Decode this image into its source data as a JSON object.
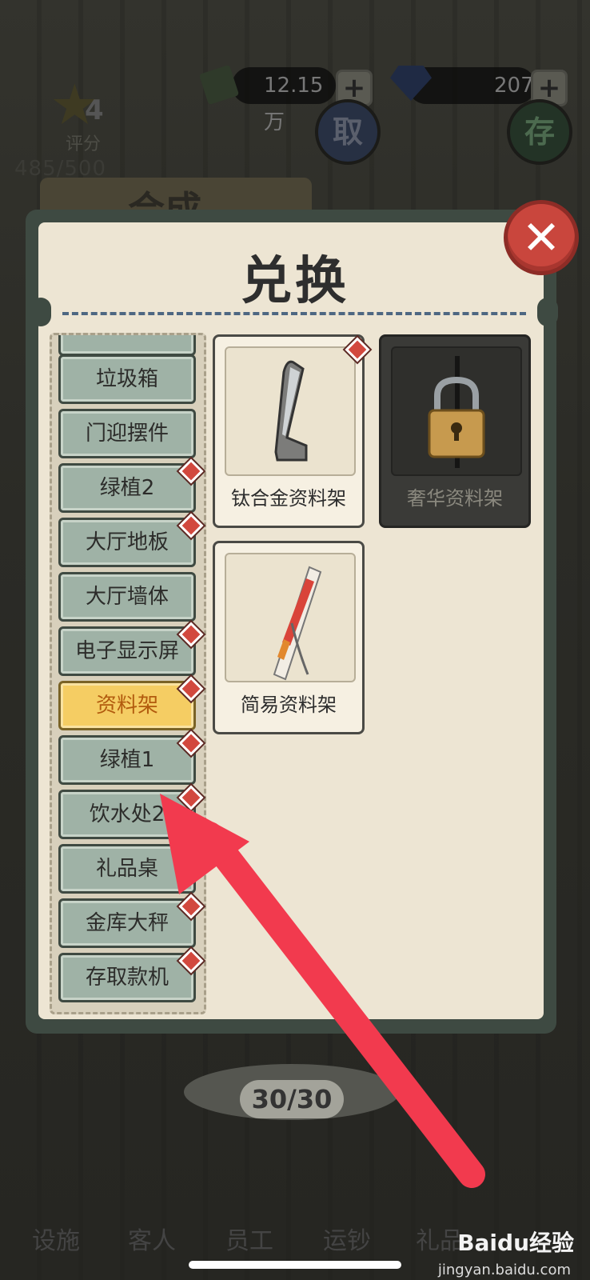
{
  "hud": {
    "cash": "12.15万",
    "diamonds": "207",
    "plus": "+",
    "rank_level": "4",
    "rank_label": "评分",
    "rank_score": "485/500",
    "withdraw_label": "取",
    "deposit_label": "存",
    "back_panel_title": "合成"
  },
  "modal": {
    "title": "兑换",
    "close_symbol": "✕"
  },
  "categories": [
    {
      "label": "垃圾箱",
      "badge": false,
      "selected": false
    },
    {
      "label": "门迎摆件",
      "badge": false,
      "selected": false
    },
    {
      "label": "绿植2",
      "badge": true,
      "selected": false
    },
    {
      "label": "大厅地板",
      "badge": true,
      "selected": false
    },
    {
      "label": "大厅墙体",
      "badge": false,
      "selected": false
    },
    {
      "label": "电子显示屏",
      "badge": true,
      "selected": false
    },
    {
      "label": "资料架",
      "badge": true,
      "selected": true
    },
    {
      "label": "绿植1",
      "badge": true,
      "selected": false
    },
    {
      "label": "饮水处2",
      "badge": true,
      "selected": false
    },
    {
      "label": "礼品桌",
      "badge": false,
      "selected": false
    },
    {
      "label": "金库大秤",
      "badge": true,
      "selected": false
    },
    {
      "label": "存取款机",
      "badge": true,
      "selected": false
    }
  ],
  "items": [
    {
      "label": "钛合金资料架",
      "locked": false,
      "badge": true
    },
    {
      "label": "奢华资料架",
      "locked": true,
      "badge": false
    },
    {
      "label": "简易资料架",
      "locked": false,
      "badge": false
    }
  ],
  "progress": "30/30",
  "bottom_nav": [
    "设施",
    "客人",
    "员工",
    "运钞",
    "礼品"
  ],
  "watermark": {
    "brand": "Baidu经验",
    "url": "jingyan.baidu.com"
  },
  "colors": {
    "accent": "#f5cd63",
    "badge": "#d2483e",
    "arrow": "#f23a4e"
  }
}
